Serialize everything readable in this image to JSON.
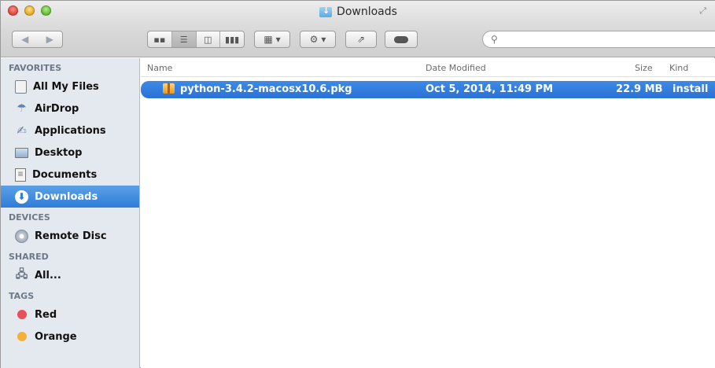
{
  "window": {
    "title": "Downloads",
    "fullscreen_glyph": "⤢"
  },
  "toolbar": {
    "back_glyph": "◀",
    "forward_glyph": "▶",
    "view_icons": [
      "icon-view-icon",
      "list-view-icon",
      "column-view-icon",
      "cover-flow-icon"
    ],
    "search_placeholder": ""
  },
  "sidebar": {
    "sections": [
      {
        "header": "FAVORITES",
        "items": [
          {
            "label": "All My Files",
            "icon": "all-files-icon"
          },
          {
            "label": "AirDrop",
            "icon": "airdrop-icon"
          },
          {
            "label": "Applications",
            "icon": "applications-icon"
          },
          {
            "label": "Desktop",
            "icon": "desktop-icon"
          },
          {
            "label": "Documents",
            "icon": "documents-icon"
          },
          {
            "label": "Downloads",
            "icon": "downloads-icon",
            "selected": true
          }
        ]
      },
      {
        "header": "DEVICES",
        "items": [
          {
            "label": "Remote Disc",
            "icon": "remote-disc-icon"
          }
        ]
      },
      {
        "header": "SHARED",
        "items": [
          {
            "label": "All...",
            "icon": "shared-network-icon"
          }
        ]
      },
      {
        "header": "TAGS",
        "items": [
          {
            "label": "Red",
            "icon": "tag-dot-icon",
            "color": "#e8505b"
          },
          {
            "label": "Orange",
            "icon": "tag-dot-icon",
            "color": "#f3b13a"
          }
        ]
      }
    ]
  },
  "columns": {
    "name": "Name",
    "date": "Date Modified",
    "size": "Size",
    "kind": "Kind"
  },
  "files": [
    {
      "name": "python-3.4.2-macosx10.6.pkg",
      "date": "Oct 5, 2014, 11:49 PM",
      "size": "22.9 MB",
      "kind": "install",
      "selected": true
    }
  ],
  "colors": {
    "selection": "#2f7dd9",
    "sidebar_bg": "#e4e9ef",
    "section_header": "#6d7888"
  }
}
